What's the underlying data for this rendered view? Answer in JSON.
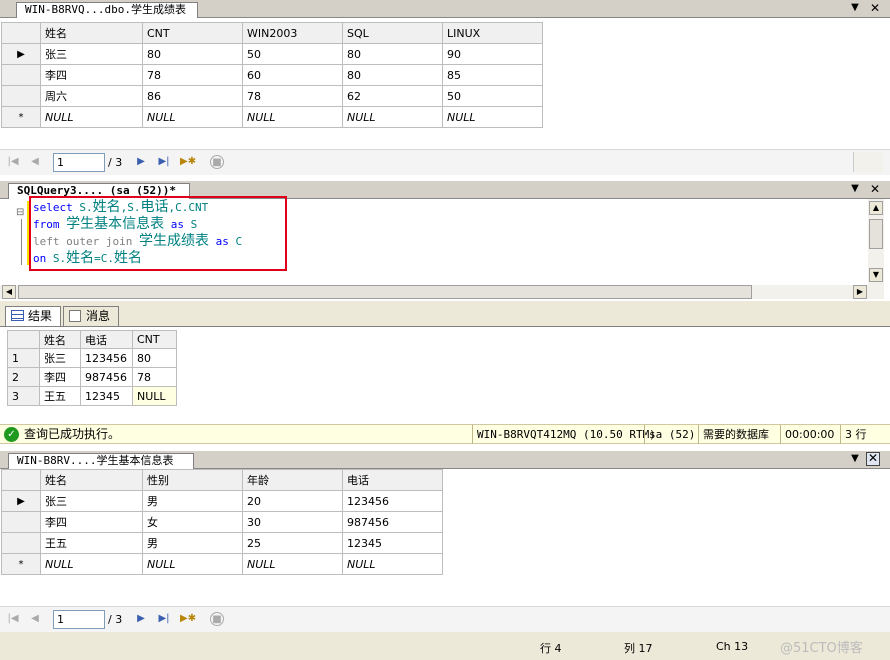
{
  "top_panel": {
    "tab_title": "WIN-B8RVQ...dbo.学生成绩表",
    "columns": [
      "姓名",
      "CNT",
      "WIN2003",
      "SQL",
      "LINUX"
    ],
    "rows": [
      [
        "张三",
        "80",
        "50",
        "80",
        "90"
      ],
      [
        "李四",
        "78",
        "60",
        "80",
        "85"
      ],
      [
        "周六",
        "86",
        "78",
        "62",
        "50"
      ]
    ],
    "null_label": "NULL",
    "new_row_marker": "*",
    "current_row_marker": "▶",
    "nav": {
      "page": "1",
      "total": "/ 3"
    }
  },
  "query_panel": {
    "tab_title": "SQLQuery3....  (sa (52))*",
    "code": {
      "l1_kw": "select",
      "l1_a": "S.",
      "l1_b": "姓名",
      "l1_c": ",S.",
      "l1_d": "电话",
      "l1_e": ",C.CNT",
      "l2_kw": "from",
      "l2_table": "学生基本信息表",
      "l2_as": "as",
      "l2_alias": "S",
      "l3_kw": "left outer join",
      "l3_table": "学生成绩表",
      "l3_as": "as",
      "l3_alias": "C",
      "l4_kw": "on",
      "l4_a": "S.",
      "l4_b": "姓名",
      "l4_c": "=C.",
      "l4_d": "姓名"
    },
    "collapse_marker": "⊟"
  },
  "results": {
    "tab_results": "结果",
    "tab_messages": "消息",
    "columns": [
      "姓名",
      "电话",
      "CNT"
    ],
    "rows": [
      [
        "1",
        "张三",
        "123456",
        "80"
      ],
      [
        "2",
        "李四",
        "987456",
        "78"
      ],
      [
        "3",
        "王五",
        "12345",
        "NULL"
      ]
    ]
  },
  "status": {
    "message": "查询已成功执行。",
    "server": "WIN-B8RVQT412MQ (10.50 RTM)",
    "user": "sa (52)",
    "database": "需要的数据库",
    "elapsed": "00:00:00",
    "row_count": "3 行"
  },
  "bottom_panel": {
    "tab_title": "WIN-B8RV....学生基本信息表",
    "columns": [
      "姓名",
      "性别",
      "年龄",
      "电话"
    ],
    "rows": [
      [
        "张三",
        "男",
        "20",
        "123456"
      ],
      [
        "李四",
        "女",
        "30",
        "987456"
      ],
      [
        "王五",
        "男",
        "25",
        "12345"
      ]
    ],
    "null_label": "NULL",
    "new_row_marker": "*",
    "current_row_marker": "▶",
    "nav": {
      "page": "1",
      "total": "/ 3"
    }
  },
  "editor_status": {
    "line": "行 4",
    "col": "列 17",
    "ch": "Ch 13",
    "watermark": "@51CTO博客"
  },
  "colors": {
    "status_ok": "#1f9a1f",
    "sql_keyword": "#0000ff",
    "sql_identifier": "#008080",
    "highlight_box": "#e0001b"
  }
}
